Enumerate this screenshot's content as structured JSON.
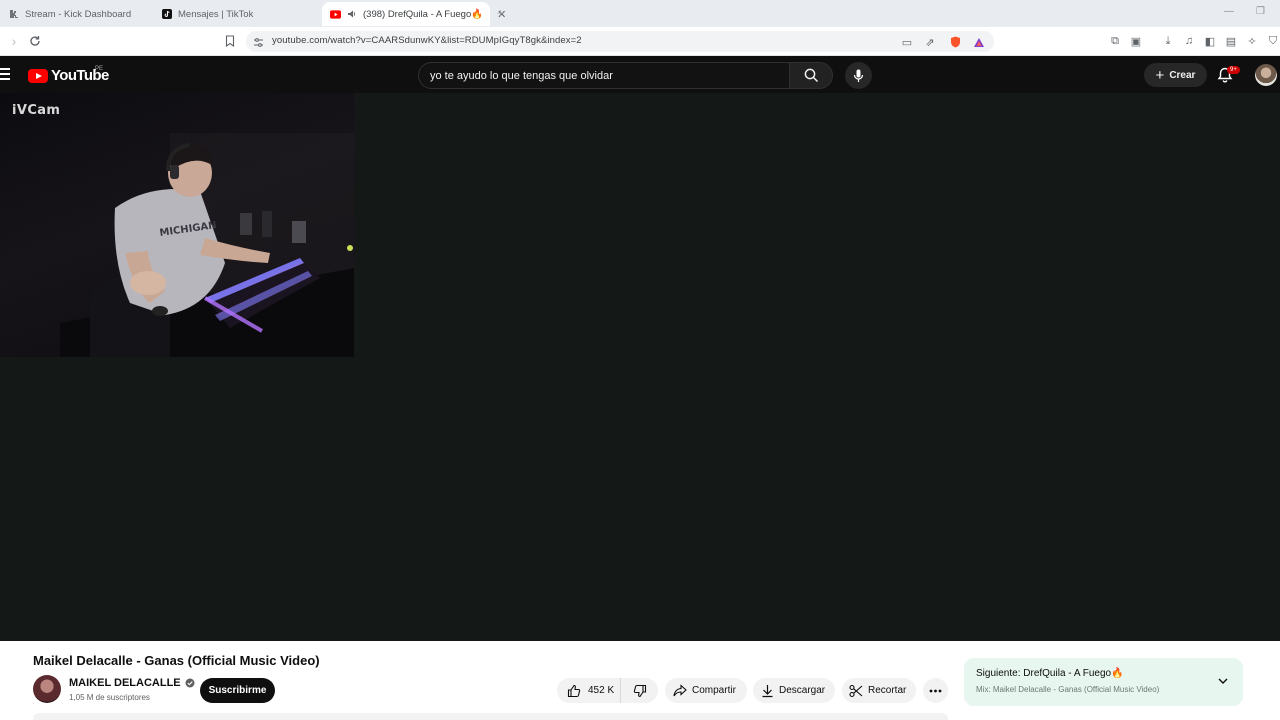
{
  "browser": {
    "tabs": [
      {
        "title": "Stream - Kick Dashboard",
        "icon": "kick-icon",
        "active": false
      },
      {
        "title": "Mensajes | TikTok",
        "icon": "tiktok-icon",
        "active": false
      },
      {
        "title": "(398) DrefQuila - A Fuego🔥",
        "icon": "youtube-icon",
        "active": true
      }
    ],
    "url": "youtube.com/watch?v=CAARSdunwKY&list=RDUMpIGqyT8gk&index=2"
  },
  "header": {
    "logo_text": "YouTube",
    "country_code": "PE",
    "search_query": "yo te ayudo lo que tengas que olvidar",
    "create_label": "Crear",
    "notification_badge": "9+"
  },
  "player": {
    "overlay_label": "iVCam"
  },
  "video": {
    "title": "Maikel Delacalle - Ganas (Official Music Video)",
    "channel_name": "MAIKEL DELACALLE",
    "subscribers": "1,05 M de suscriptores",
    "subscribe_label": "Suscribirme",
    "like_count": "452 K",
    "share_label": "Compartir",
    "download_label": "Descargar",
    "clip_label": "Recortar"
  },
  "up_next": {
    "label": "Siguiente:",
    "title": "DrefQuila - A Fuego🔥",
    "mix": "Mix: Maikel Delacalle - Ganas (Official Music Video)"
  },
  "colors": {
    "yt_red": "#ff0000",
    "player_bg": "#141817",
    "next_panel_bg": "#e7f6ef"
  }
}
